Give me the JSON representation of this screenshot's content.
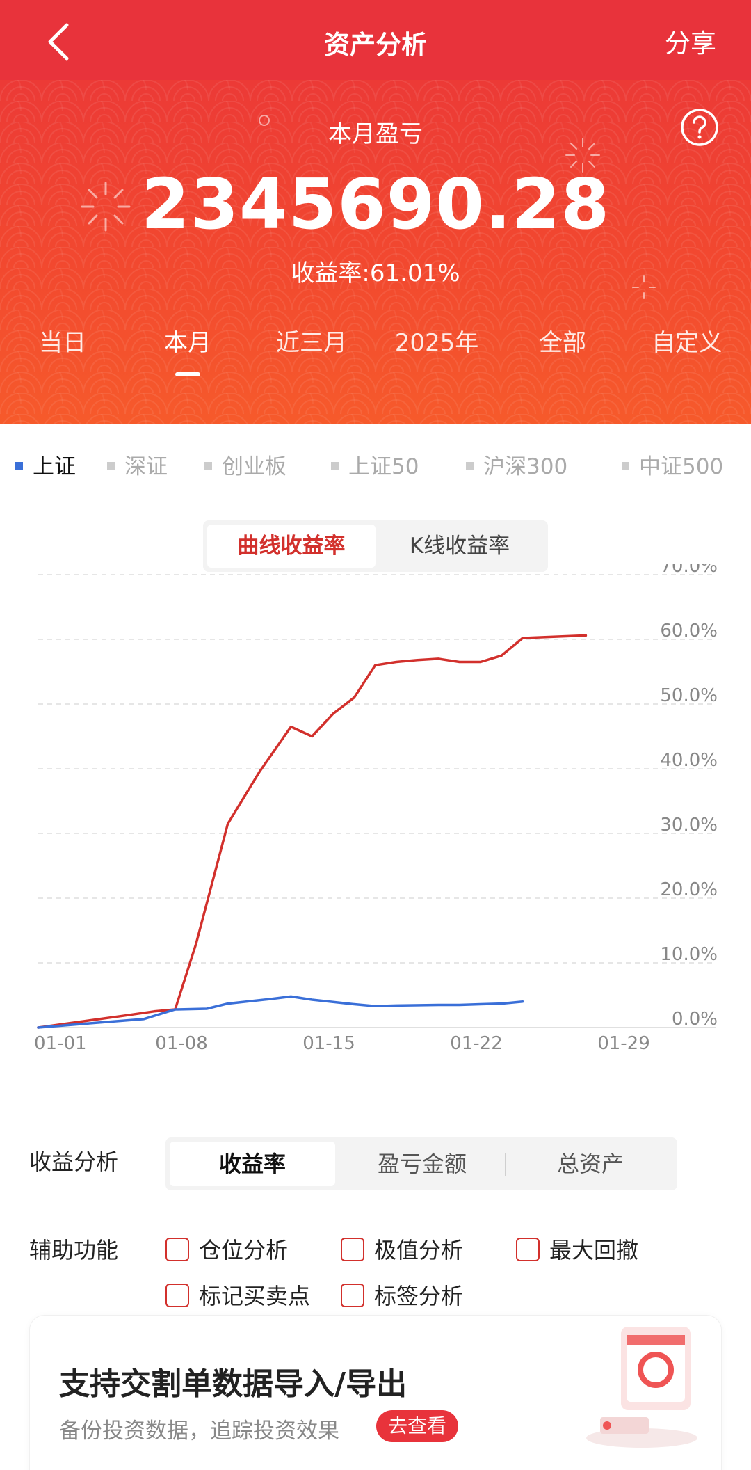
{
  "header": {
    "title": "资产分析",
    "share_label": "分享"
  },
  "hero": {
    "label": "本月盈亏",
    "value": "2345690.28",
    "rate": "收益率:61.01%"
  },
  "period_tabs": [
    {
      "label": "当日"
    },
    {
      "label": "本月",
      "active": true
    },
    {
      "label": "近三月"
    },
    {
      "label": "2025年"
    },
    {
      "label": "全部"
    },
    {
      "label": "自定义"
    }
  ],
  "index_legend": [
    {
      "label": "上证",
      "active": true
    },
    {
      "label": "深证"
    },
    {
      "label": "创业板"
    },
    {
      "label": "上证50"
    },
    {
      "label": "沪深300"
    },
    {
      "label": "中证500"
    }
  ],
  "chart_modes": {
    "active": "曲线收益率",
    "other": "K线收益率"
  },
  "chart_data": {
    "type": "line",
    "x_ticks": [
      "01-01",
      "01-08",
      "01-15",
      "01-22",
      "01-29"
    ],
    "y_ticks": [
      "70.0%",
      "60.0%",
      "50.0%",
      "40.0%",
      "30.0%",
      "20.0%",
      "10.0%",
      "0.0%"
    ],
    "ylim": [
      0,
      70
    ],
    "xlim": [
      1,
      29
    ],
    "grid": true,
    "series": [
      {
        "color": "#d2302c",
        "points": [
          [
            1,
            0
          ],
          [
            3,
            0.9
          ],
          [
            5,
            1.8
          ],
          [
            6.5,
            2.5
          ],
          [
            7.5,
            2.8
          ],
          [
            8.5,
            13
          ],
          [
            10,
            31.5
          ],
          [
            11.5,
            39.5
          ],
          [
            13,
            46.5
          ],
          [
            14,
            45
          ],
          [
            15,
            48.5
          ],
          [
            16,
            51
          ],
          [
            17,
            56
          ],
          [
            18,
            56.5
          ],
          [
            19,
            56.8
          ],
          [
            20,
            57
          ],
          [
            21,
            56.5
          ],
          [
            22,
            56.5
          ],
          [
            23,
            57.5
          ],
          [
            24,
            60.2
          ],
          [
            27,
            60.6
          ]
        ]
      },
      {
        "color": "#3a6fd8",
        "points": [
          [
            1,
            0
          ],
          [
            4,
            0.8
          ],
          [
            6,
            1.3
          ],
          [
            7.5,
            2.8
          ],
          [
            9,
            2.9
          ],
          [
            10,
            3.7
          ],
          [
            12,
            4.4
          ],
          [
            13,
            4.8
          ],
          [
            14,
            4.3
          ],
          [
            16,
            3.6
          ],
          [
            17,
            3.3
          ],
          [
            18,
            3.4
          ],
          [
            20,
            3.5
          ],
          [
            21,
            3.5
          ],
          [
            22,
            3.6
          ],
          [
            23,
            3.7
          ],
          [
            24,
            4.0
          ]
        ]
      }
    ]
  },
  "analysis": {
    "label": "收益分析",
    "options": [
      "收益率",
      "盈亏金额",
      "总资产"
    ],
    "active_index": 0
  },
  "aux": {
    "label": "辅助功能",
    "items": [
      "仓位分析",
      "极值分析",
      "最大回撤",
      "标记买卖点",
      "标签分析"
    ]
  },
  "promo": {
    "title": "支持交割单数据导入/导出",
    "subtitle": "备份投资数据，追踪投资效果",
    "badge": "去查看"
  },
  "colors": {
    "brand": "#e8333b",
    "series_portfolio": "#d2302c",
    "series_index": "#3a6fd8"
  }
}
